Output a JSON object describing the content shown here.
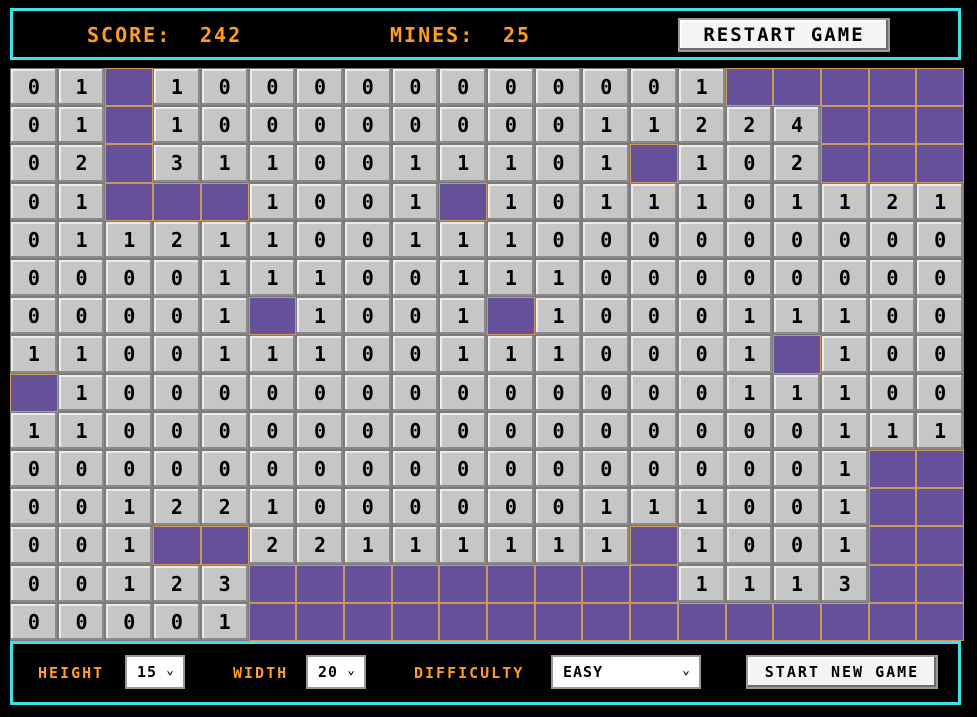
{
  "header": {
    "score_label": "SCORE:",
    "score_value": "242",
    "mines_label": "MINES:",
    "mines_value": "25",
    "restart_label": "RESTART GAME"
  },
  "board": {
    "rows": 15,
    "cols": 20,
    "hidden_symbol": "H",
    "cells": [
      [
        "0",
        "1",
        "H",
        "1",
        "0",
        "0",
        "0",
        "0",
        "0",
        "0",
        "0",
        "0",
        "0",
        "0",
        "1",
        "H",
        "H",
        "H",
        "H",
        "H"
      ],
      [
        "0",
        "1",
        "H",
        "1",
        "0",
        "0",
        "0",
        "0",
        "0",
        "0",
        "0",
        "0",
        "1",
        "1",
        "2",
        "2",
        "4",
        "H",
        "H",
        "H"
      ],
      [
        "0",
        "2",
        "H",
        "3",
        "1",
        "1",
        "0",
        "0",
        "1",
        "1",
        "1",
        "0",
        "1",
        "H",
        "1",
        "0",
        "2",
        "H",
        "H",
        "H"
      ],
      [
        "0",
        "1",
        "H",
        "H",
        "H",
        "1",
        "0",
        "0",
        "1",
        "H",
        "1",
        "0",
        "1",
        "1",
        "1",
        "0",
        "1",
        "1",
        "2",
        "1"
      ],
      [
        "0",
        "1",
        "1",
        "2",
        "1",
        "1",
        "0",
        "0",
        "1",
        "1",
        "1",
        "0",
        "0",
        "0",
        "0",
        "0",
        "0",
        "0",
        "0",
        "0"
      ],
      [
        "0",
        "0",
        "0",
        "0",
        "1",
        "1",
        "1",
        "0",
        "0",
        "1",
        "1",
        "1",
        "0",
        "0",
        "0",
        "0",
        "0",
        "0",
        "0",
        "0"
      ],
      [
        "0",
        "0",
        "0",
        "0",
        "1",
        "H",
        "1",
        "0",
        "0",
        "1",
        "H",
        "1",
        "0",
        "0",
        "0",
        "1",
        "1",
        "1",
        "0",
        "0"
      ],
      [
        "1",
        "1",
        "0",
        "0",
        "1",
        "1",
        "1",
        "0",
        "0",
        "1",
        "1",
        "1",
        "0",
        "0",
        "0",
        "1",
        "H",
        "1",
        "0",
        "0"
      ],
      [
        "H",
        "1",
        "0",
        "0",
        "0",
        "0",
        "0",
        "0",
        "0",
        "0",
        "0",
        "0",
        "0",
        "0",
        "0",
        "1",
        "1",
        "1",
        "0",
        "0"
      ],
      [
        "1",
        "1",
        "0",
        "0",
        "0",
        "0",
        "0",
        "0",
        "0",
        "0",
        "0",
        "0",
        "0",
        "0",
        "0",
        "0",
        "0",
        "1",
        "1",
        "1"
      ],
      [
        "0",
        "0",
        "0",
        "0",
        "0",
        "0",
        "0",
        "0",
        "0",
        "0",
        "0",
        "0",
        "0",
        "0",
        "0",
        "0",
        "0",
        "1",
        "H",
        "H"
      ],
      [
        "0",
        "0",
        "1",
        "2",
        "2",
        "1",
        "0",
        "0",
        "0",
        "0",
        "0",
        "0",
        "1",
        "1",
        "1",
        "0",
        "0",
        "1",
        "H",
        "H"
      ],
      [
        "0",
        "0",
        "1",
        "H",
        "H",
        "2",
        "2",
        "1",
        "1",
        "1",
        "1",
        "1",
        "1",
        "H",
        "1",
        "0",
        "0",
        "1",
        "H",
        "H"
      ],
      [
        "0",
        "0",
        "1",
        "2",
        "3",
        "H",
        "H",
        "H",
        "H",
        "H",
        "H",
        "H",
        "H",
        "H",
        "1",
        "1",
        "1",
        "3",
        "H",
        "H"
      ],
      [
        "0",
        "0",
        "0",
        "0",
        "1",
        "H",
        "H",
        "H",
        "H",
        "H",
        "H",
        "H",
        "H",
        "H",
        "H",
        "H",
        "H",
        "H",
        "H",
        "H"
      ]
    ]
  },
  "footer": {
    "height_label": "HEIGHT",
    "height_value": "15",
    "width_label": "WIDTH",
    "width_value": "20",
    "difficulty_label": "DIFFICULTY",
    "difficulty_value": "EASY",
    "start_label": "START NEW GAME"
  },
  "colors": {
    "accent_orange": "#ff9d1f",
    "border_cyan": "#3fe0e6",
    "hidden_tile": "#67509a",
    "revealed_tile": "#c6c6c6"
  }
}
